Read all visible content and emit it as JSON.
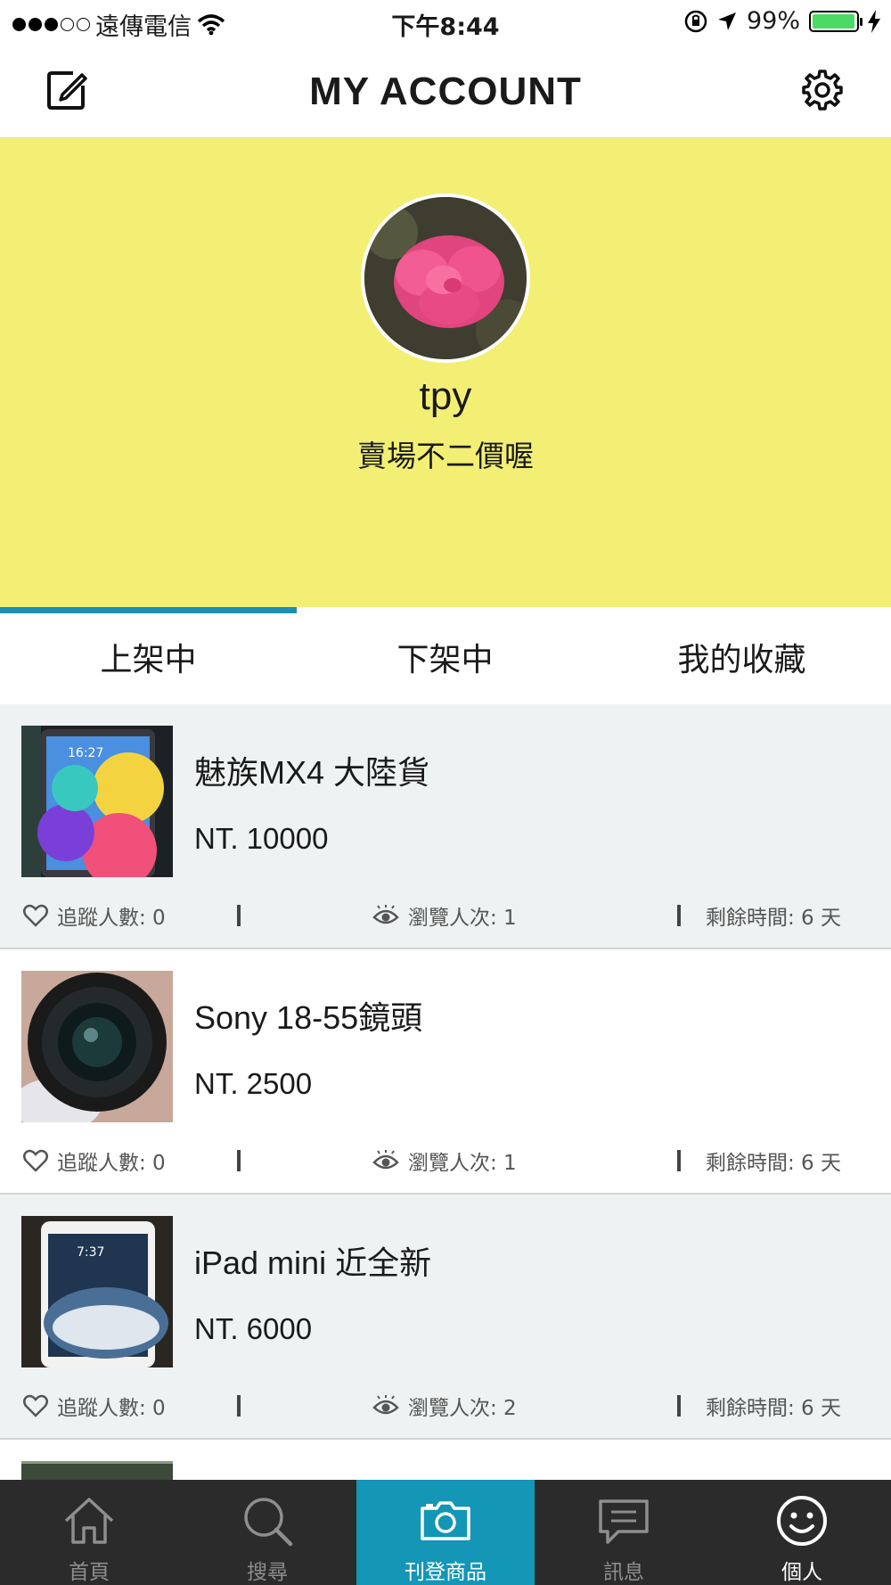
{
  "status_bar": {
    "carrier": "遠傳電信",
    "time": "下午8:44",
    "battery": "99%",
    "battery_level": 0.99
  },
  "nav": {
    "title": "MY ACCOUNT",
    "edit_icon": "edit-icon",
    "settings_icon": "gear-icon"
  },
  "profile": {
    "username": "tpy",
    "bio": "賣場不二價喔",
    "background": "#f3ef74"
  },
  "tabs": [
    {
      "label": "上架中",
      "active": true
    },
    {
      "label": "下架中",
      "active": false
    },
    {
      "label": "我的收藏",
      "active": false
    }
  ],
  "listings": [
    {
      "title": "魅族MX4 大陸貨",
      "price": "NT. 10000",
      "followers": "追蹤人數: 0",
      "views": "瀏覽人次: 1",
      "remaining": "剩餘時間: 6 天"
    },
    {
      "title": "Sony 18-55鏡頭",
      "price": "NT. 2500",
      "followers": "追蹤人數: 0",
      "views": "瀏覽人次: 1",
      "remaining": "剩餘時間: 6 天"
    },
    {
      "title": "iPad mini 近全新",
      "price": "NT. 6000",
      "followers": "追蹤人數: 0",
      "views": "瀏覽人次: 2",
      "remaining": "剩餘時間: 6 天"
    }
  ],
  "tabbar": [
    {
      "label": "首頁",
      "icon": "home-icon"
    },
    {
      "label": "搜尋",
      "icon": "search-icon"
    },
    {
      "label": "刊登商品",
      "icon": "camera-icon"
    },
    {
      "label": "訊息",
      "icon": "chat-icon"
    },
    {
      "label": "個人",
      "icon": "smiley-icon"
    }
  ],
  "colors": {
    "accent": "#1b8fb5",
    "post_tab": "#1496b6",
    "tabbar_bg": "#2b2b2b",
    "listing_grey": "#eff2f2"
  }
}
